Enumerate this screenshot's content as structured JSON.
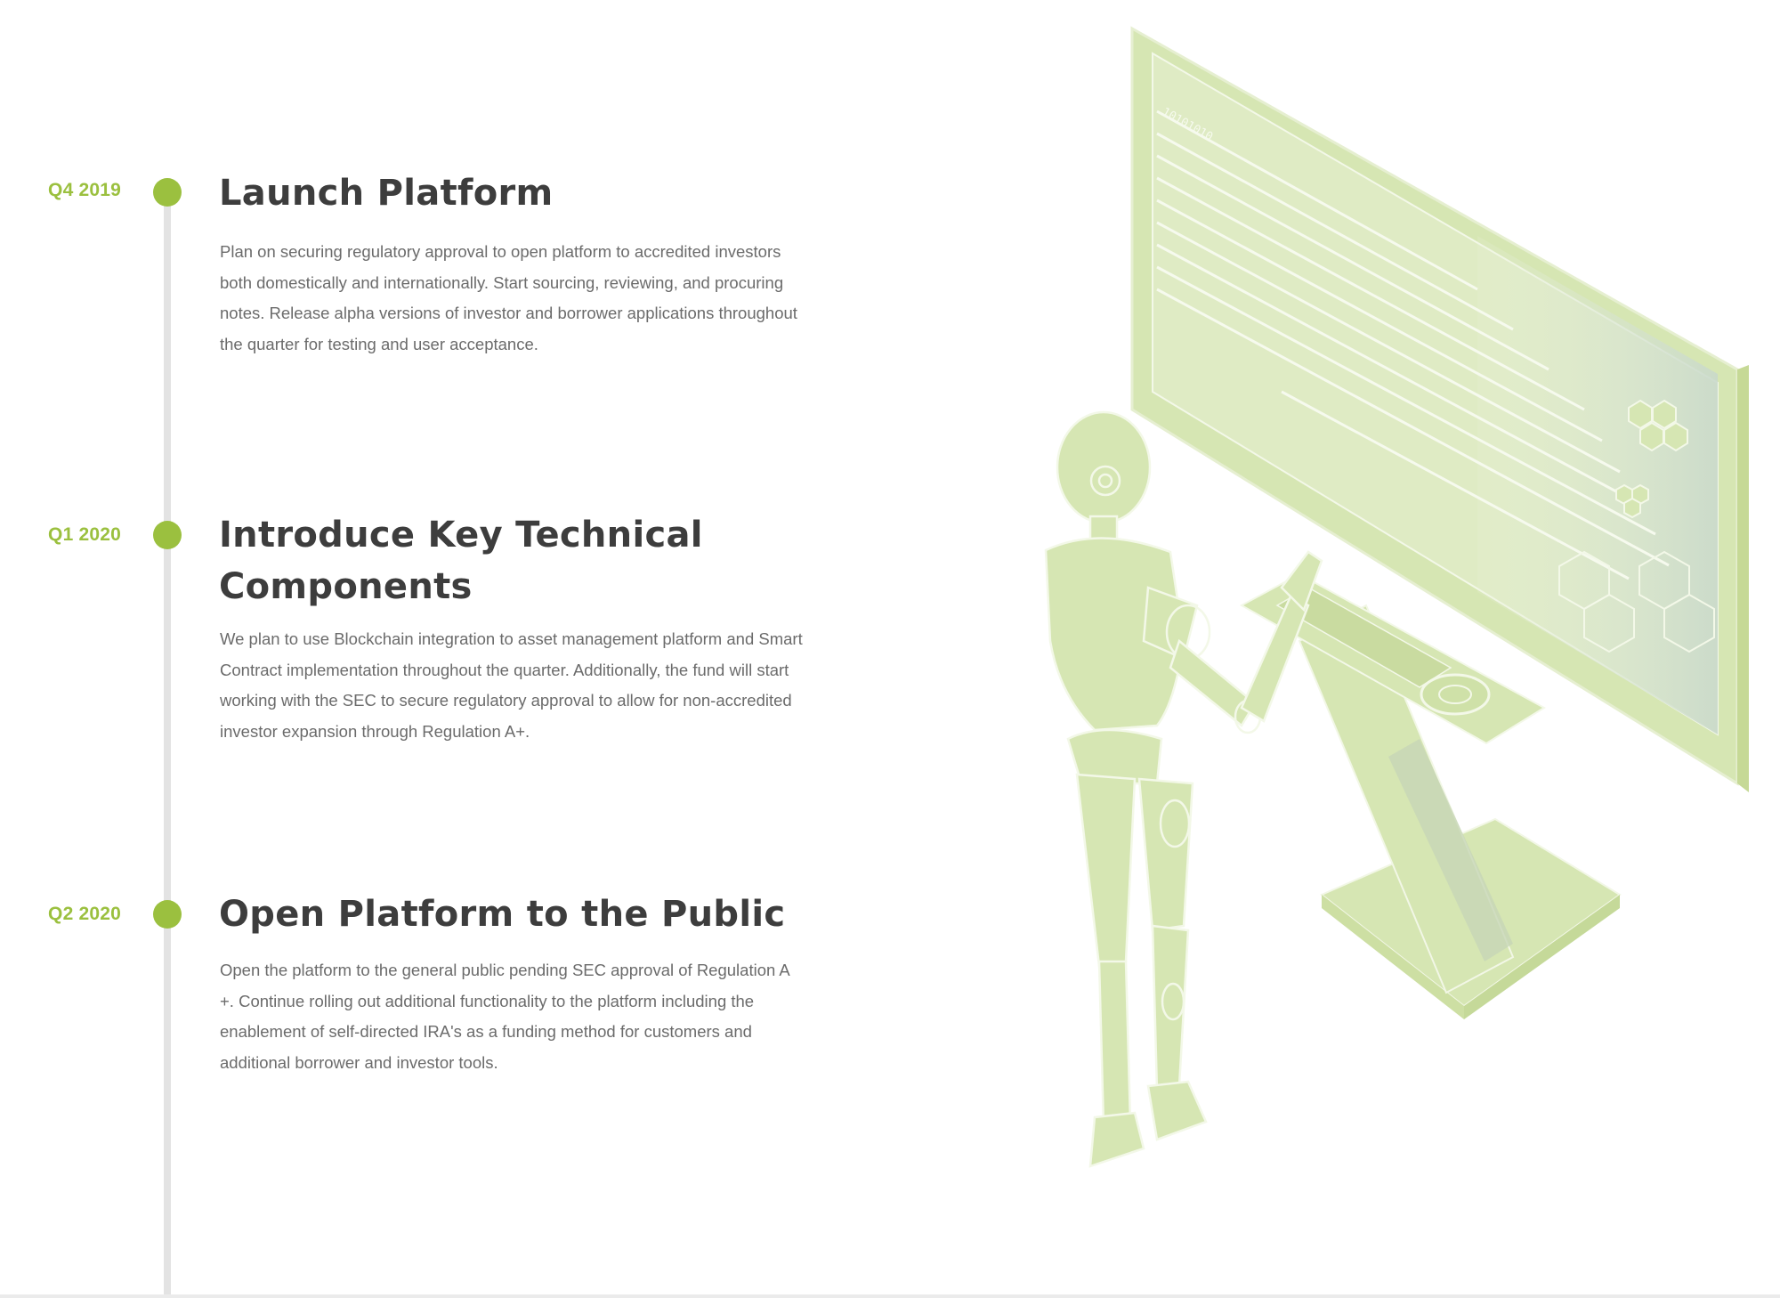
{
  "timeline": {
    "milestones": [
      {
        "date": "Q4 2019",
        "title": "Launch Platform",
        "description": "Plan on securing regulatory approval to open platform to accredited investors both domestically and internationally. Start sourcing, reviewing, and procuring notes. Release alpha versions of investor and borrower applications throughout the quarter for testing and user acceptance."
      },
      {
        "date": "Q1 2020",
        "title": "Introduce Key Technical Components",
        "description": "We plan to use Blockchain integration to asset management platform and Smart Contract implementation throughout the quarter. Additionally, the fund will start working with the SEC to secure regulatory approval to allow for non-accredited investor expansion through Regulation A+."
      },
      {
        "date": "Q2 2020",
        "title": "Open Platform to the Public",
        "description": "Open the platform to the general public pending SEC approval of Regulation A +. Continue rolling out additional functionality to the platform including the enablement of self-directed IRA's as a funding method for customers and additional borrower and investor tools."
      }
    ]
  },
  "illustration": {
    "icon": "robot-at-computer-illustration",
    "screen_text": "10101010"
  },
  "colors": {
    "accent": "#9bc03f",
    "title": "#3d3d3d",
    "body_text": "#6b6b6b",
    "timeline_line": "#e3e3e3",
    "illustration": "#d6e6b3"
  }
}
